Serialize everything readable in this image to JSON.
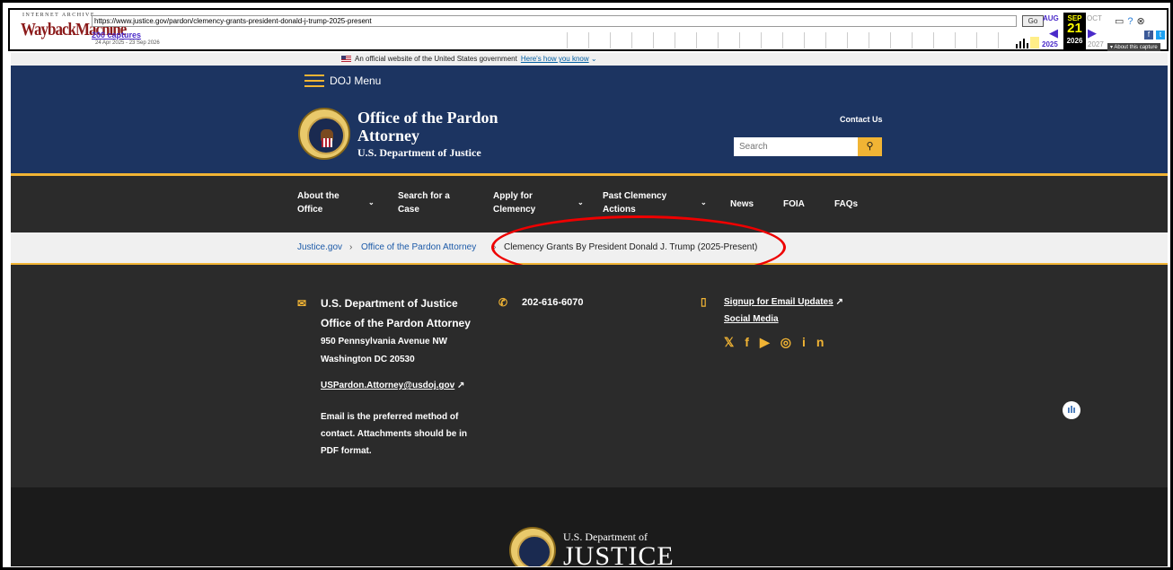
{
  "wayback": {
    "logo_top": "INTERNET ARCHIVE",
    "logo": "WaybackMachine",
    "url": "https://www.justice.gov/pardon/clemency-grants-president-donald-j-trump-2025-present",
    "go": "Go",
    "captures": "200 captures",
    "range": "24 Apr 2025 - 23 Sep 2026",
    "prev_month": "AUG",
    "cur_month": "SEP",
    "next_month": "OCT",
    "day": "21",
    "prev_year": "2025",
    "cur_year": "2026",
    "next_year": "2027",
    "about": "About this capture"
  },
  "gov_banner": {
    "text": "An official website of the United States government",
    "link": "Here's how you know"
  },
  "doj_menu": {
    "label": "DOJ Menu"
  },
  "header": {
    "title": "Office of the Pardon Attorney",
    "subtitle": "U.S. Department of Justice",
    "contact": "Contact Us",
    "search_placeholder": "Search"
  },
  "nav": {
    "items": [
      {
        "label": "About the Office"
      },
      {
        "label": "Search for a Case"
      },
      {
        "label": "Apply for Clemency"
      },
      {
        "label": "Past Clemency Actions"
      },
      {
        "label": "News"
      },
      {
        "label": "FOIA"
      },
      {
        "label": "FAQs"
      }
    ]
  },
  "breadcrumb": {
    "items": [
      {
        "label": "Justice.gov"
      },
      {
        "label": "Office of the Pardon Attorney"
      },
      {
        "label": "Clemency Grants By President Donald J. Trump (2025-Present)"
      }
    ]
  },
  "footer": {
    "org1": "U.S. Department of Justice",
    "org2": "Office of the Pardon Attorney",
    "addr1": "950 Pennsylvania Avenue NW",
    "addr2": "Washington DC 20530",
    "email": "USPardon.Attorney@usdoj.gov",
    "note": "Email is the preferred method of contact. Attachments should be in PDF format.",
    "phone": "202-616-6070",
    "signup": "Signup for Email Updates",
    "social": "Social Media"
  },
  "footer_bottom": {
    "dept": "U.S. Department of",
    "justice": "JUSTICE"
  },
  "colors": {
    "navy": "#1c3461",
    "gold": "#f1b434",
    "dark": "#2b2b2b",
    "highlight": "#e00000"
  }
}
